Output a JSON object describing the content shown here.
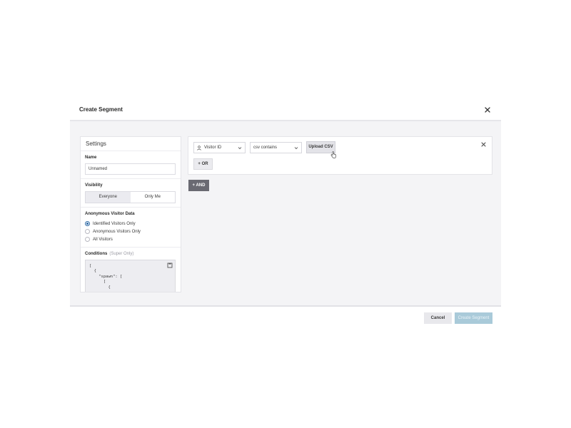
{
  "modal": {
    "title": "Create Segment",
    "close_icon": "close-icon"
  },
  "settings": {
    "title": "Settings",
    "name_label": "Name",
    "name_value": "Unnamed",
    "visibility_label": "Visibility",
    "visibility_options": [
      "Everyone",
      "Only Me"
    ],
    "visibility_selected": "Everyone",
    "anon_label": "Anonymous Visitor Data",
    "anon_options": [
      "Identified Visitors Only",
      "Anonymous Visitors Only",
      "All Visitors"
    ],
    "anon_selected": "Identified Visitors Only",
    "conditions_label": "Conditions",
    "conditions_note": "(Super Only)",
    "conditions_code": "[\n  {\n    \"spawn\": [\n      [\n        {"
  },
  "rule": {
    "attribute": "Visitor ID",
    "attribute_icon": "person-icon",
    "operator": "csv contains",
    "upload_label": "Upload CSV",
    "or_label": "+ OR"
  },
  "and_label": "+ AND",
  "footer": {
    "cancel_label": "Cancel",
    "create_label": "Create Segment"
  },
  "colors": {
    "primary_disabled": "#a9cad9",
    "and_button": "#6a6a72",
    "radio_selected": "#2e6aa5"
  }
}
